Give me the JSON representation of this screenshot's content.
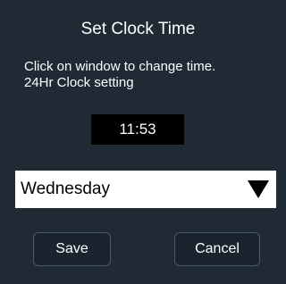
{
  "dialog": {
    "title": "Set Clock Time",
    "instruction_line1": "Click on window to change time.",
    "instruction_line2": "24Hr Clock setting"
  },
  "time": {
    "value": "11:53"
  },
  "day_select": {
    "selected": "Wednesday",
    "icon": "triangle-down-icon"
  },
  "buttons": {
    "save_label": "Save",
    "cancel_label": "Cancel"
  },
  "colors": {
    "background": "#1f2a35",
    "time_box": "#000000",
    "select_background": "#ffffff",
    "button_border": "#4a5866"
  }
}
